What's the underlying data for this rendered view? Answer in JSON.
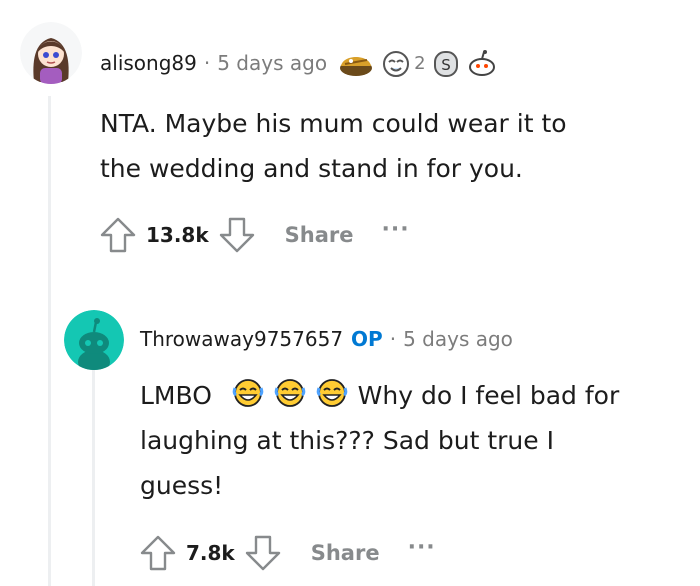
{
  "comment1": {
    "username": "alisong89",
    "separator": "·",
    "time": "5 days ago",
    "award_count": "2",
    "body_lines": [
      "NTA. Maybe his mum could wear it to",
      "the wedding and stand in for you."
    ],
    "score": "13.8k",
    "share_label": "Share",
    "more_label": "···"
  },
  "comment2": {
    "username": "Throwaway9757657",
    "op_badge": "OP",
    "separator": "·",
    "time": "5 days ago",
    "body_line1_start": "LMBO",
    "body_line1_end": "Why do I feel bad for",
    "body_line2": "laughing at this??? Sad but true I",
    "body_line3": "guess!",
    "score": "7.8k",
    "share_label": "Share",
    "more_label": "···"
  },
  "colors": {
    "op_blue": "#0079d3",
    "meta_gray": "#7c7c7c",
    "action_gray": "#878a8c",
    "avatar_teal": "#14c7b3"
  },
  "icons": [
    "upvote-icon",
    "downvote-icon",
    "laughing-emoji-icon",
    "award-icon",
    "avatar-icon"
  ]
}
